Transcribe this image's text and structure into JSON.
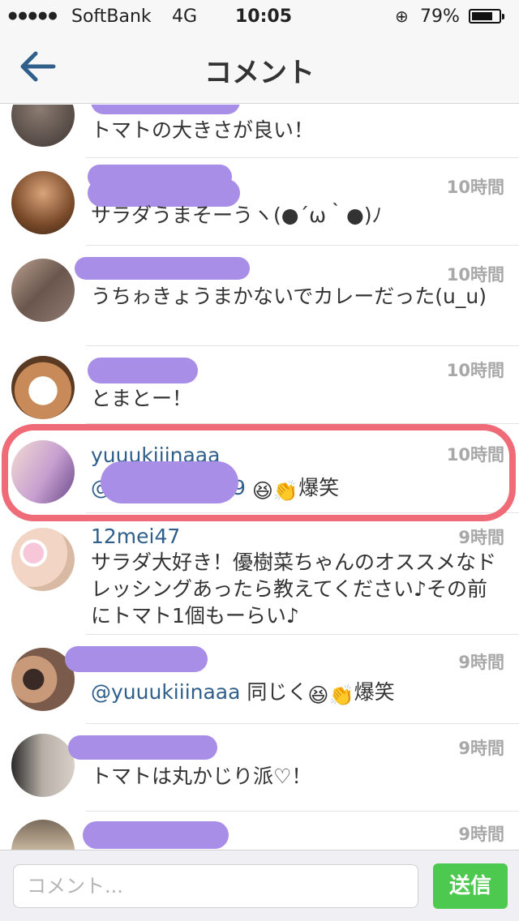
{
  "status_bar": {
    "signal": "●●●●●",
    "carrier": "SoftBank",
    "network": "4G",
    "time": "10:05",
    "lock_icon": "⊕",
    "battery": "79%",
    "battery_level": 0.79
  },
  "nav": {
    "title": "コメント",
    "back_icon": "arrow-left-icon"
  },
  "comments": [
    {
      "username": "",
      "text": "トマトの大きさが良い！",
      "time": ""
    },
    {
      "username": "",
      "text": "サラダうまそーうヽ(●´ω｀●)ﾉ",
      "time": "10時間"
    },
    {
      "username": "",
      "text": "うちゎきょうまかないでカレーだった(u_u)",
      "time": "10時間"
    },
    {
      "username": "",
      "text": "とまとー！",
      "time": "10時間"
    },
    {
      "username": "yuuukiiinaaa",
      "text_prefix": "@",
      "text_suffix": "9",
      "emoji": "😆👏",
      "text_after": "爆笑",
      "time": "10時間"
    },
    {
      "username": "12mei47",
      "text": "サラダ大好き！優樹菜ちゃんのオススメなドレッシングあったら教えてください♪その前にトマト1個もーらい♪",
      "time": "9時間"
    },
    {
      "username": "",
      "mention": "@yuuukiiinaaa",
      "text_after": " 同じく",
      "emoji": "😆👏",
      "text_end": "爆笑",
      "time": "9時間"
    },
    {
      "username": "",
      "text": "トマトは丸かじり派♡！",
      "time": "9時間"
    },
    {
      "username": "",
      "text": "",
      "time": "9時間"
    }
  ],
  "compose": {
    "placeholder": "コメント...",
    "send_label": "送信"
  },
  "colors": {
    "accent_link": "#2f5f8a",
    "send_button": "#4cc94e",
    "highlight_stroke": "#ee6b77",
    "redaction": "#a98ee8"
  }
}
